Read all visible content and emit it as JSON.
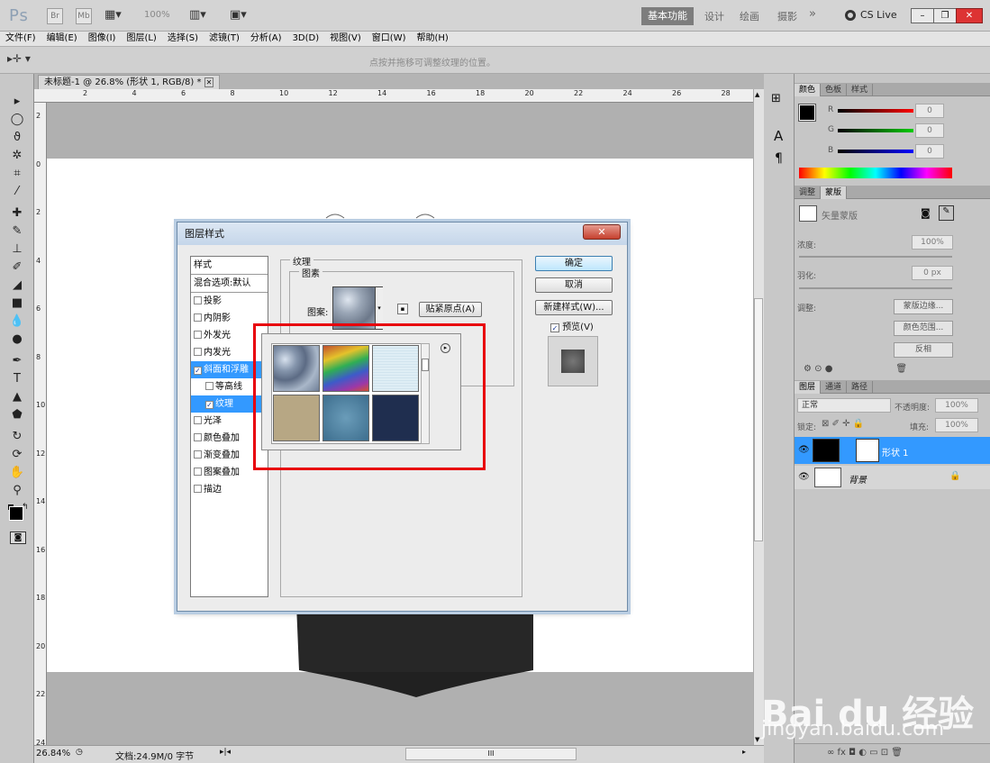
{
  "app": {
    "logo": "Ps",
    "bridge_label": "Br",
    "minibridge_label": "Mb",
    "zoom": "100%",
    "workspaces": [
      "基本功能",
      "设计",
      "绘画",
      "摄影"
    ],
    "more": "»",
    "cs_live": "CS Live",
    "window_buttons": [
      "–",
      "❐",
      "✕"
    ]
  },
  "menu": [
    "文件(F)",
    "编辑(E)",
    "图像(I)",
    "图层(L)",
    "选择(S)",
    "滤镜(T)",
    "分析(A)",
    "3D(D)",
    "视图(V)",
    "窗口(W)",
    "帮助(H)"
  ],
  "options": {
    "hint": "点按并拖移可调整纹理的位置。"
  },
  "document": {
    "tab_title": "未标题-1 @ 26.8% (形状 1, RGB/8) *",
    "ruler_h": [
      "2",
      "4",
      "6",
      "8",
      "10",
      "12",
      "14",
      "16",
      "18",
      "20",
      "22",
      "24",
      "26",
      "28"
    ],
    "ruler_v": [
      "2",
      "0",
      "2",
      "4",
      "6",
      "8",
      "10",
      "12",
      "14",
      "16",
      "18",
      "20",
      "22",
      "24"
    ]
  },
  "status": {
    "zoom": "26.84%",
    "doc": "文档:24.9M/0 字节",
    "scroll_mark": "III"
  },
  "dialog": {
    "title": "图层样式",
    "close": "✕",
    "styles_header": "样式",
    "blend_options": "混合选项:默认",
    "items": [
      {
        "label": "投影",
        "checked": false
      },
      {
        "label": "内阴影",
        "checked": false
      },
      {
        "label": "外发光",
        "checked": false
      },
      {
        "label": "内发光",
        "checked": false
      },
      {
        "label": "斜面和浮雕",
        "checked": true
      },
      {
        "label": "等高线",
        "checked": false
      },
      {
        "label": "纹理",
        "checked": true
      },
      {
        "label": "光泽",
        "checked": false
      },
      {
        "label": "颜色叠加",
        "checked": false
      },
      {
        "label": "渐变叠加",
        "checked": false
      },
      {
        "label": "图案叠加",
        "checked": false
      },
      {
        "label": "描边",
        "checked": false
      }
    ],
    "section_title": "纹理",
    "pattern_group": "图素",
    "pattern_label": "图案:",
    "snap_button": "贴紧原点(A)",
    "ok": "确定",
    "cancel": "取消",
    "new_style": "新建样式(W)...",
    "preview_label": "预览(V)",
    "preview_checked": true
  },
  "panels": {
    "color_tabs": [
      "颜色",
      "色板",
      "样式"
    ],
    "rgb_labels": [
      "R",
      "G",
      "B"
    ],
    "rgb_values": [
      "0",
      "0",
      "0"
    ],
    "mask_tabs": [
      "调整",
      "蒙版"
    ],
    "mask_title": "矢量蒙版",
    "density_label": "浓度:",
    "density_value": "100%",
    "feather_label": "羽化:",
    "feather_value": "0 px",
    "refine_label": "调整:",
    "mask_edge_btn": "蒙版边缘...",
    "color_range_btn": "颜色范围...",
    "invert_btn": "反相",
    "layer_tabs": [
      "图层",
      "通道",
      "路径"
    ],
    "blend_mode": "正常",
    "opacity_label": "不透明度:",
    "opacity_value": "100%",
    "lock_label": "锁定:",
    "fill_label": "填充:",
    "fill_value": "100%",
    "layers": [
      {
        "name": "形状 1",
        "selected": true
      },
      {
        "name": "背景",
        "selected": false
      }
    ]
  },
  "dock": {
    "a_label": "A",
    "para_label": "¶"
  },
  "watermark": {
    "line1": "Bai du 经验",
    "line2": "jingyan.baidu.com"
  }
}
